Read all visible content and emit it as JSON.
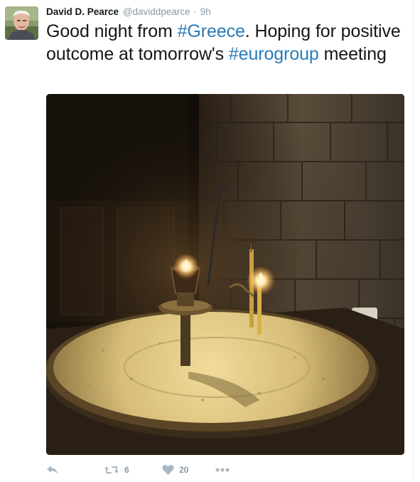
{
  "tweet": {
    "author": {
      "name": "David D. Pearce",
      "handle": "@daviddpearce",
      "avatar_icon": "author-avatar"
    },
    "separator": "·",
    "time": "9h",
    "text": {
      "part1": "Good night from ",
      "hashtag1": "#Greece",
      "part2": ". Hoping for positive outcome at tomorrow's ",
      "hashtag2": "#eurogroup",
      "part3": " meeting"
    },
    "media": {
      "icon": "photo"
    },
    "actions": {
      "reply_icon": "reply-icon",
      "retweet_icon": "retweet-icon",
      "retweet_count": "6",
      "like_icon": "heart-icon",
      "like_count": "20",
      "more_icon": "more-icon"
    }
  },
  "colors": {
    "link": "#2b7bb9",
    "muted": "#8899a6",
    "action_icon": "#aab8c2"
  }
}
